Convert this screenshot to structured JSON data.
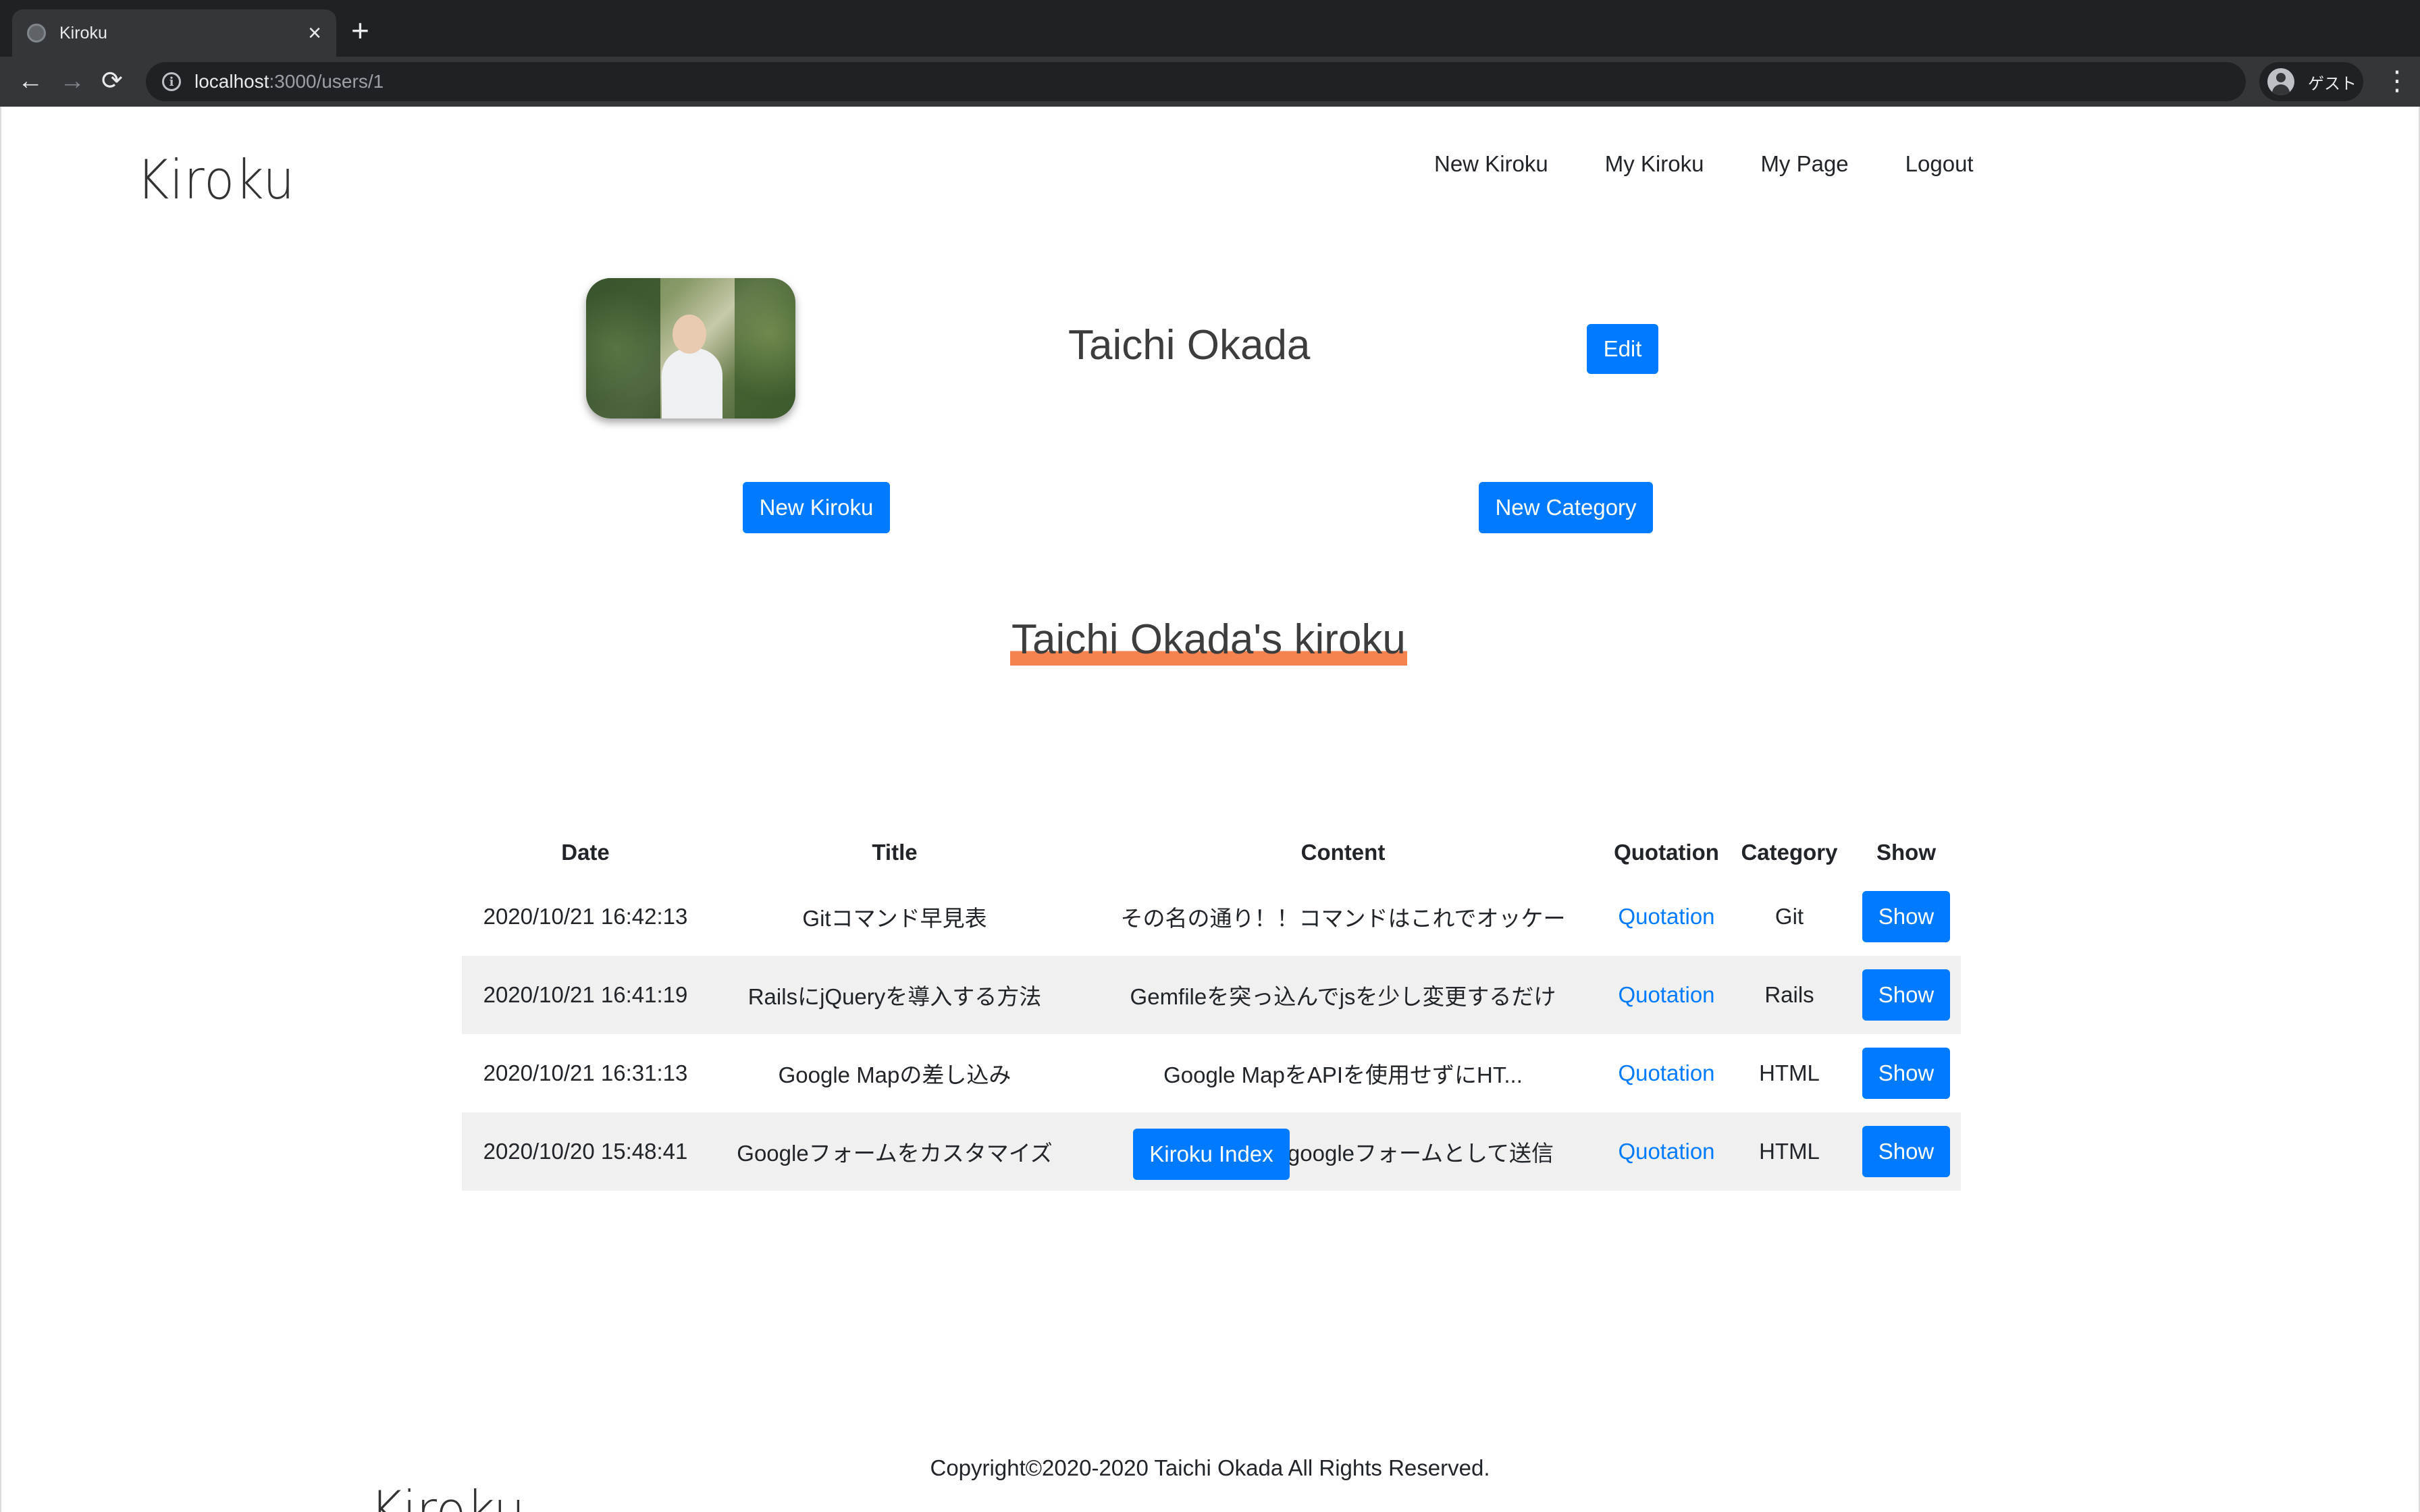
{
  "browser": {
    "tab_title": "Kiroku",
    "tab_close": "×",
    "new_tab": "+",
    "back": "←",
    "forward": "→",
    "reload": "⟳",
    "info": "i",
    "url_host": "localhost",
    "url_path": ":3000/users/1",
    "profile_label": "ゲスト",
    "menu": "⋮"
  },
  "header": {
    "logo": "Kiroku",
    "nav": [
      "New Kiroku",
      "My Kiroku",
      "My Page",
      "Logout"
    ]
  },
  "profile": {
    "name": "Taichi Okada",
    "edit_label": "Edit"
  },
  "actions": {
    "new_kiroku": "New Kiroku",
    "new_category": "New Category"
  },
  "section_title": "Taichi Okada's kiroku",
  "table": {
    "headers": [
      "Date",
      "Title",
      "Content",
      "Quotation",
      "Category",
      "Show"
    ],
    "rows": [
      {
        "date": "2020/10/21 16:42:13",
        "title": "Gitコマンド早見表",
        "content": "その名の通り！！コマンドはこれでオッケー",
        "quotation": "Quotation",
        "category": "Git",
        "show": "Show"
      },
      {
        "date": "2020/10/21 16:41:19",
        "title": "RailsにjQueryを導入する方法",
        "content": "Gemfileを突っ込んでjsを少し変更するだけ",
        "quotation": "Quotation",
        "category": "Rails",
        "show": "Show"
      },
      {
        "date": "2020/10/21 16:31:13",
        "title": "Google Mapの差し込み",
        "content": "Google MapをAPIを使用せずにHT...",
        "quotation": "Quotation",
        "category": "HTML",
        "show": "Show"
      },
      {
        "date": "2020/10/20 15:48:41",
        "title": "Googleフォームをカスタマイズ",
        "content": "独自フォームをgoogleフォームとして送信",
        "quotation": "Quotation",
        "category": "HTML",
        "show": "Show"
      }
    ]
  },
  "index_button": "Kiroku Index",
  "footer": {
    "copyright": "Copyright©2020-2020 Taichi Okada All Rights Reserved.",
    "logo": "Kiroku"
  }
}
